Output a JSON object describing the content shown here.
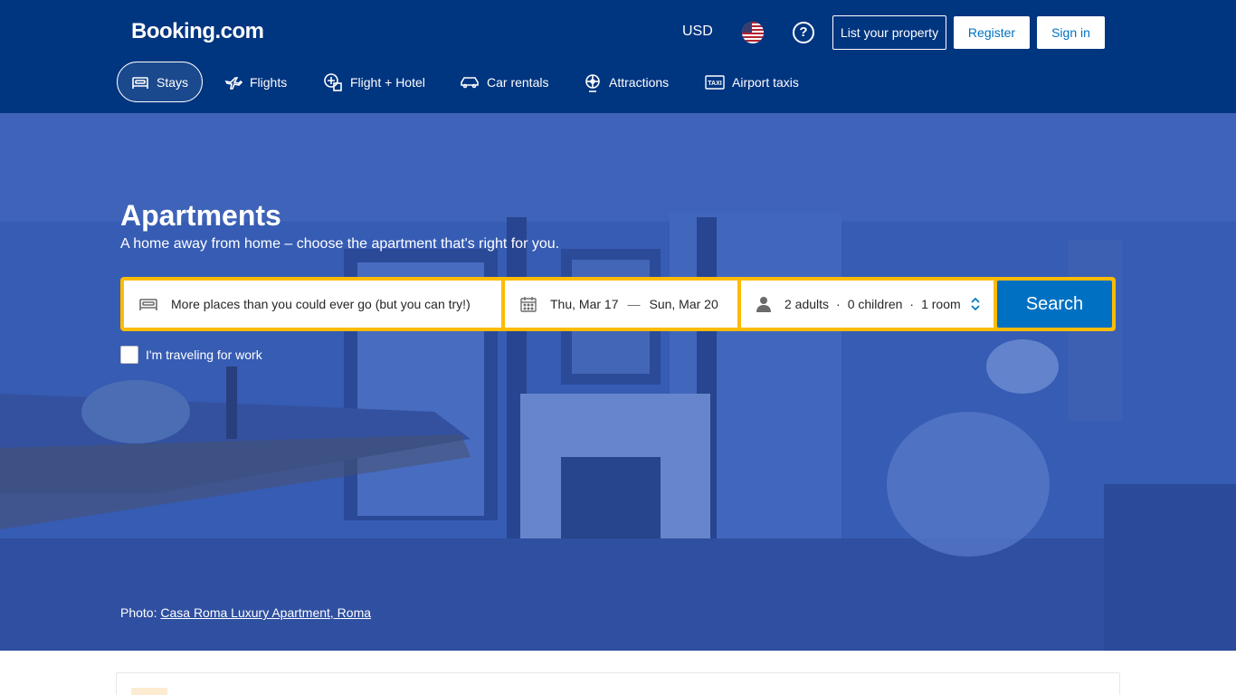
{
  "header": {
    "logo": "Booking.com",
    "currency": "USD",
    "flag_icon": "us-flag-icon",
    "help_icon": "question-circle-icon",
    "list_property": "List your property",
    "register": "Register",
    "sign_in": "Sign in"
  },
  "nav": [
    {
      "label": "Stays",
      "icon": "bed-icon",
      "active": true
    },
    {
      "label": "Flights",
      "icon": "plane-icon",
      "active": false
    },
    {
      "label": "Flight + Hotel",
      "icon": "flight-hotel-icon",
      "active": false
    },
    {
      "label": "Car rentals",
      "icon": "car-icon",
      "active": false
    },
    {
      "label": "Attractions",
      "icon": "attractions-icon",
      "active": false
    },
    {
      "label": "Airport taxis",
      "icon": "taxi-icon",
      "active": false
    }
  ],
  "hero": {
    "title": "Apartments",
    "subtitle": "A home away from home – choose the apartment that's right for you.",
    "photo_prefix": "Photo: ",
    "photo_link": "Casa Roma Luxury Apartment, Roma"
  },
  "search": {
    "destination_placeholder": "More places than you could ever go (but you can try!)",
    "checkin": "Thu, Mar 17",
    "dash": "—",
    "checkout": "Sun, Mar 20",
    "adults": "2 adults",
    "children": "0 children",
    "rooms": "1 room",
    "dot": "·",
    "button": "Search",
    "work_label": "I'm traveling for work"
  },
  "colors": {
    "brand": "#003580",
    "search_border": "#febb02",
    "primary": "#0071c2"
  }
}
